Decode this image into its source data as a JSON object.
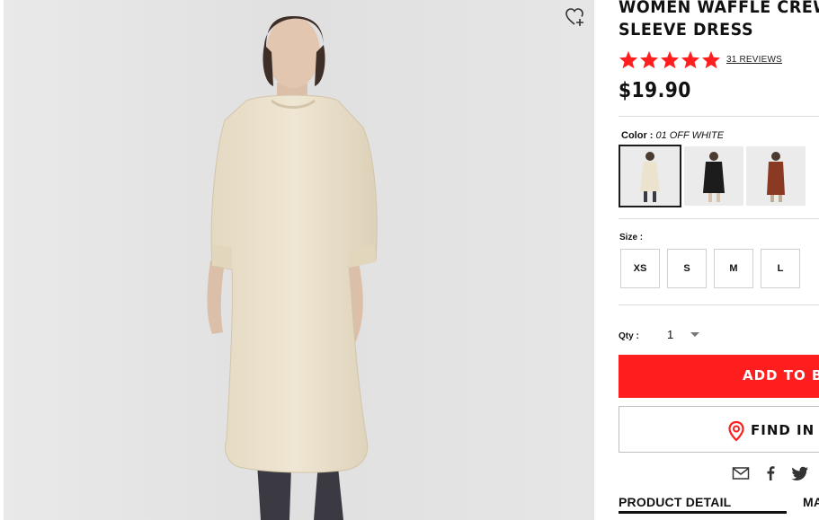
{
  "product": {
    "title_line1": "WOMEN WAFFLE CREW",
    "title_line2": "SLEEVE DRESS",
    "rating_stars": 5,
    "reviews_label": "31 REVIEWS",
    "price": "$19.90"
  },
  "color": {
    "label": "Color :",
    "selected_value": "01 OFF WHITE",
    "swatches": [
      {
        "name": "off-white",
        "dress_color": "#ece3cf",
        "selected": true
      },
      {
        "name": "black",
        "dress_color": "#1c1c1c",
        "selected": false
      },
      {
        "name": "brown",
        "dress_color": "#8a3a22",
        "selected": false
      }
    ]
  },
  "size": {
    "label": "Size :",
    "options": [
      "XS",
      "S",
      "M",
      "L"
    ]
  },
  "quantity": {
    "label": "Qty :",
    "value": "1"
  },
  "actions": {
    "add_to_bag": "ADD TO BA",
    "find_in_store": "FIND IN ST"
  },
  "share_icons": [
    "mail-icon",
    "facebook-icon",
    "twitter-icon"
  ],
  "tabs": [
    "PRODUCT DETAIL",
    "MA"
  ],
  "colors": {
    "accent_red": "#ff1e1e",
    "hero_background": "#e3e3e3",
    "dress": "#ece3cf"
  }
}
